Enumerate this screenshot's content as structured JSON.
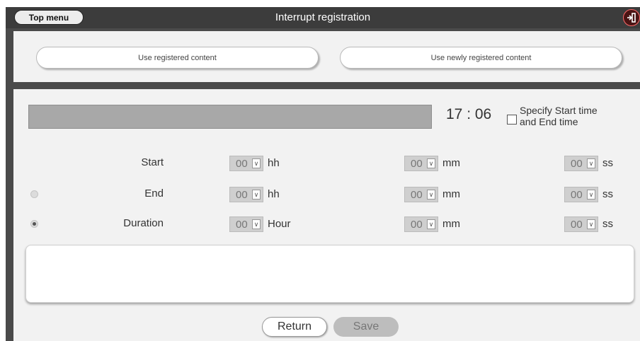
{
  "header": {
    "top_menu_label": "Top menu",
    "title": "Interrupt registration",
    "exit_icon": "exit-door-icon"
  },
  "content_choice": {
    "registered_label": "Use registered content",
    "new_label": "Use newly registered content"
  },
  "time": {
    "clock": "17 : 06",
    "specify_checked": false,
    "specify_label_line1": "Specify Start time",
    "specify_label_line2": "and End time"
  },
  "rows": [
    {
      "label": "Start",
      "hour": "00",
      "hour_unit": "hh",
      "minute": "00",
      "minute_unit": "mm",
      "second": "00",
      "second_unit": "ss"
    },
    {
      "label": "End",
      "hour": "00",
      "hour_unit": "hh",
      "minute": "00",
      "minute_unit": "mm",
      "second": "00",
      "second_unit": "ss",
      "radio_selected": false
    },
    {
      "label": "Duration",
      "hour": "00",
      "hour_unit": "Hour",
      "minute": "00",
      "minute_unit": "mm",
      "second": "00",
      "second_unit": "ss",
      "radio_selected": true
    }
  ],
  "footer": {
    "return_label": "Return",
    "save_label": "Save"
  },
  "colors": {
    "frame": "#4a4a4a",
    "panel": "#f2f2f2",
    "exit_button": "#4a1414"
  }
}
